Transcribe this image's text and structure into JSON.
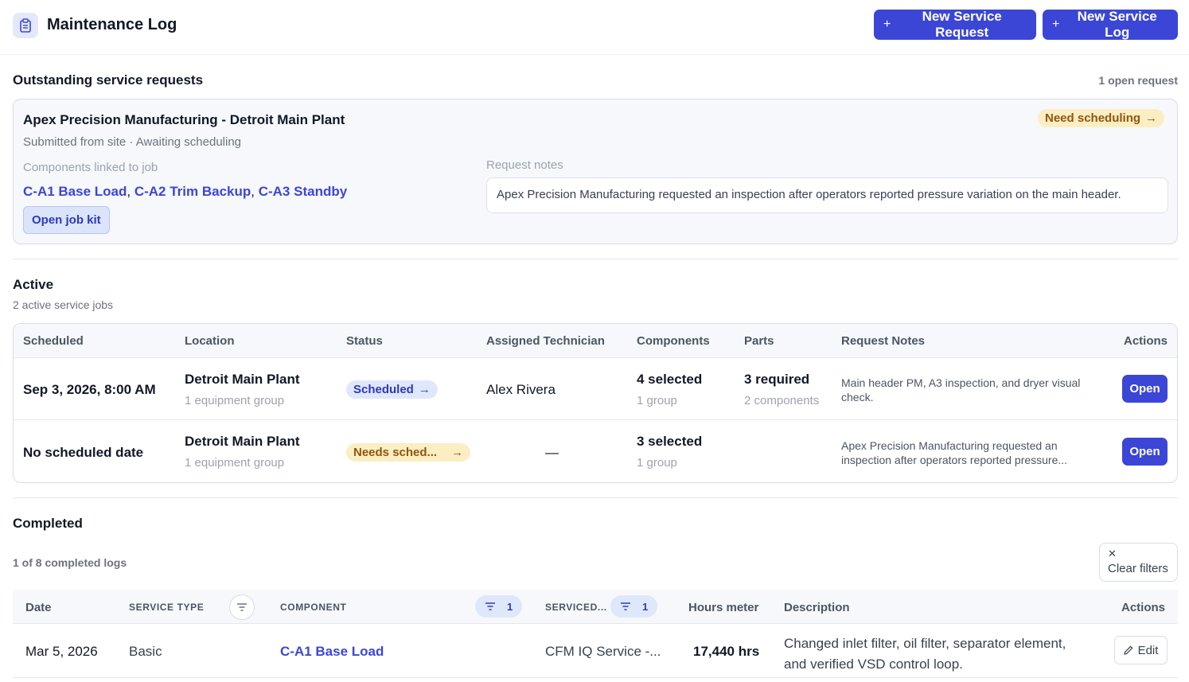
{
  "header": {
    "title": "Maintenance Log",
    "logo_icon": "clipboard-icon",
    "new_request_label": "New Service Request",
    "new_log_label": "New Service Log",
    "accent_color": "#3b46d6"
  },
  "outstanding": {
    "title": "Outstanding service requests",
    "count_label": "1 open request",
    "request": {
      "title": "Apex Precision Manufacturing - Detroit Main Plant",
      "subtitle": "Submitted from site · Awaiting scheduling",
      "badge": "Need scheduling",
      "components_label": "Components linked to job",
      "components": [
        "C-A1 Base Load",
        "C-A2 Trim Backup",
        "C-A3 Standby"
      ],
      "open_kit_label": "Open job kit",
      "notes_label": "Request notes",
      "notes": "Apex Precision Manufacturing requested an inspection after operators reported pressure variation on the main header."
    }
  },
  "active": {
    "title": "Active",
    "subtitle": "2 active service jobs",
    "columns": [
      "Scheduled",
      "Location",
      "Status",
      "Assigned Technician",
      "Components",
      "Parts",
      "Request Notes",
      "Actions"
    ],
    "rows": [
      {
        "scheduled": "Sep 3, 2026, 8:00 AM",
        "location": "Detroit Main Plant",
        "location_sub": "1 equipment group",
        "status": "Scheduled",
        "technician": "Alex Rivera",
        "components": "4 selected",
        "components_sub": "1 group",
        "parts": "3 required",
        "parts_sub": "2 components",
        "notes": "Main header PM, A3 inspection, and dryer visual check.",
        "action": "Open"
      },
      {
        "scheduled": "No scheduled date",
        "location": "Detroit Main Plant",
        "location_sub": "1 equipment group",
        "status": "Needs sched...",
        "technician": "—",
        "components": "3 selected",
        "components_sub": "1 group",
        "parts": "",
        "parts_sub": "",
        "notes": "Apex Precision Manufacturing requested an inspection after operators reported pressure...",
        "action": "Open"
      }
    ]
  },
  "completed": {
    "title": "Completed",
    "count_label": "1 of 8 completed logs",
    "clear_filters_label": "Clear filters",
    "columns": {
      "date": "Date",
      "service_type": "SERVICE TYPE",
      "component": "COMPONENT",
      "component_filter_count": "1",
      "serviced": "SERVICED...",
      "serviced_filter_count": "1",
      "hours": "Hours meter",
      "description": "Description",
      "actions": "Actions"
    },
    "rows": [
      {
        "date": "Mar 5, 2026",
        "service_type": "Basic",
        "component": "C-A1 Base Load",
        "serviced": "CFM IQ Service -...",
        "hours": "17,440 hrs",
        "description_line1": "Changed inlet filter, oil filter, separator element,",
        "description_line2": "and verified VSD control loop.",
        "action": "Edit"
      }
    ]
  }
}
